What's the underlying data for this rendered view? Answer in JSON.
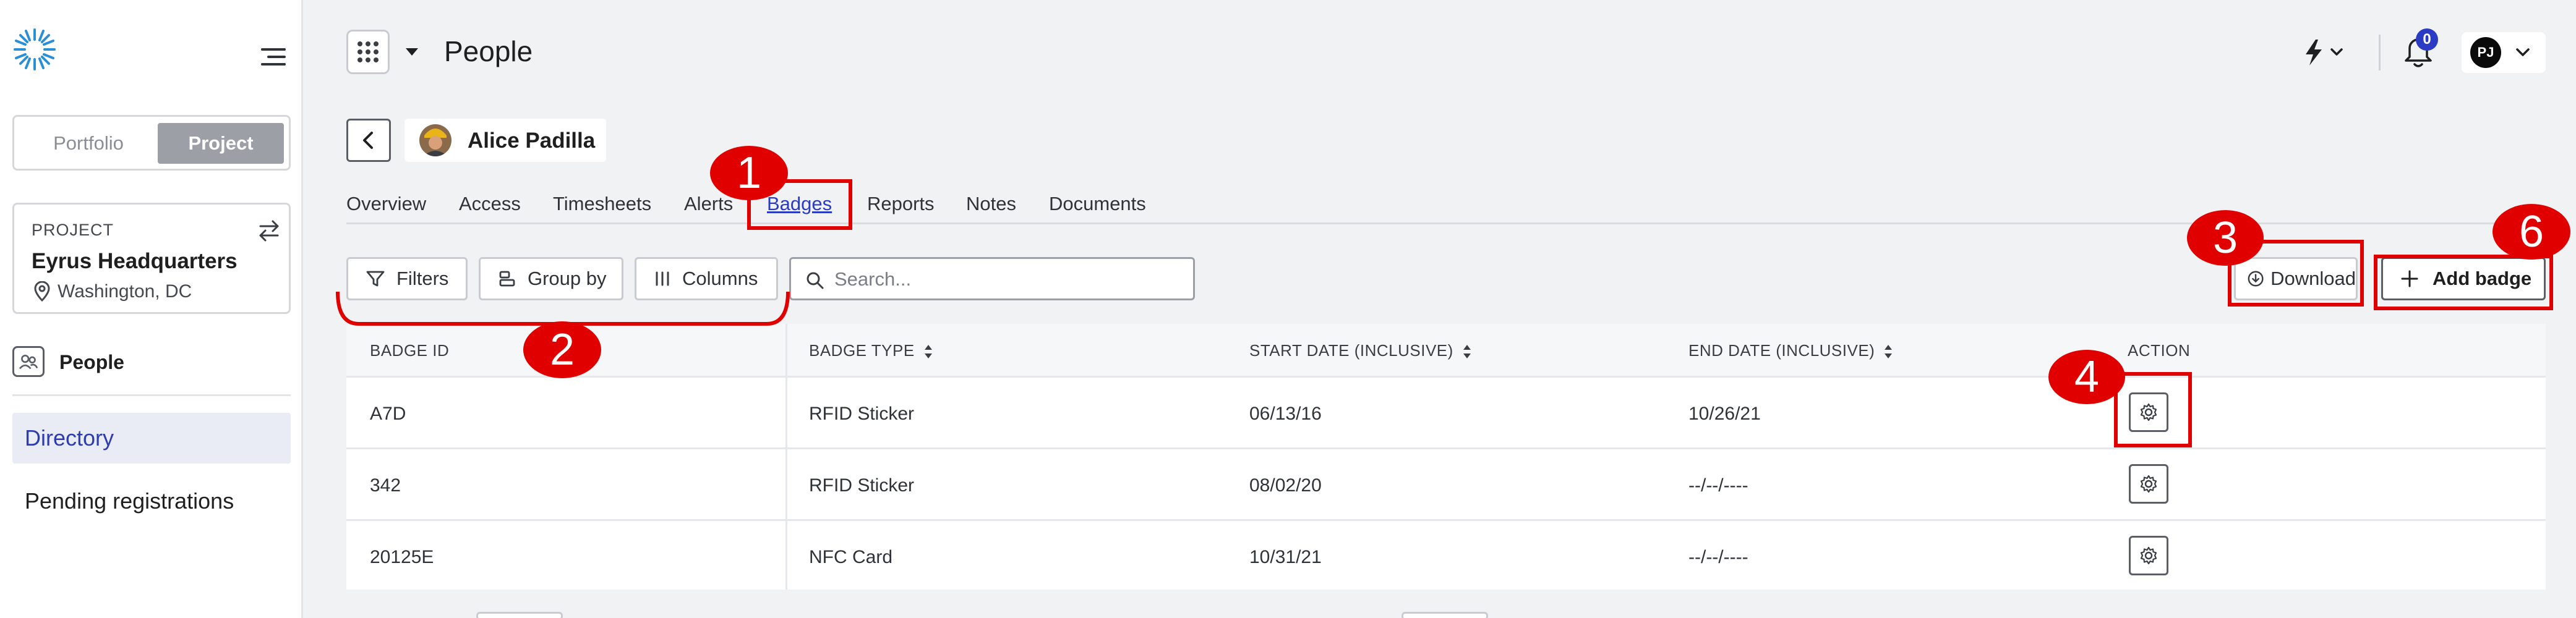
{
  "sidebar": {
    "portfolio_label": "Portfolio",
    "project_label": "Project",
    "project_card": {
      "label": "PROJECT",
      "name": "Eyrus Headquarters",
      "location": "Washington, DC"
    },
    "section_label": "People",
    "nav_items": [
      "Directory",
      "Pending registrations"
    ],
    "active_nav": "Directory"
  },
  "header": {
    "title": "People",
    "notification_count": "0",
    "user_initials": "PJ"
  },
  "person": {
    "name": "Alice Padilla"
  },
  "tabs": [
    "Overview",
    "Access",
    "Timesheets",
    "Alerts",
    "Badges",
    "Reports",
    "Notes",
    "Documents"
  ],
  "active_tab": "Badges",
  "toolbar": {
    "filters_label": "Filters",
    "groupby_label": "Group by",
    "columns_label": "Columns",
    "search_placeholder": "Search...",
    "download_label": "Download",
    "add_label": "Add badge"
  },
  "table": {
    "columns": [
      "BADGE ID",
      "BADGE TYPE",
      "START DATE (INCLUSIVE)",
      "END DATE (INCLUSIVE)",
      "ACTION"
    ],
    "rows": [
      {
        "badge_id": "A7D",
        "badge_type": "RFID Sticker",
        "start_date": "06/13/16",
        "end_date": "10/26/21"
      },
      {
        "badge_id": "342",
        "badge_type": "RFID Sticker",
        "start_date": "08/02/20",
        "end_date": "--/--/----"
      },
      {
        "badge_id": "20125E",
        "badge_type": "NFC Card",
        "start_date": "10/31/21",
        "end_date": "--/--/----"
      }
    ]
  },
  "annotations": [
    "1",
    "2",
    "3",
    "4",
    "6"
  ],
  "colors": {
    "accent": "#2b3cc4",
    "annotation": "#e00000",
    "active_nav_bg": "#e9ebf5"
  },
  "icons": [
    "eyrus-logo-icon",
    "hamburger-icon",
    "swap-icon",
    "pin-icon",
    "people-icon",
    "apps-grid-icon",
    "bolt-icon",
    "bell-icon",
    "back-arrow-icon",
    "filter-icon",
    "group-icon",
    "columns-icon",
    "search-icon",
    "download-icon",
    "plus-icon",
    "sort-icon",
    "gear-icon"
  ]
}
